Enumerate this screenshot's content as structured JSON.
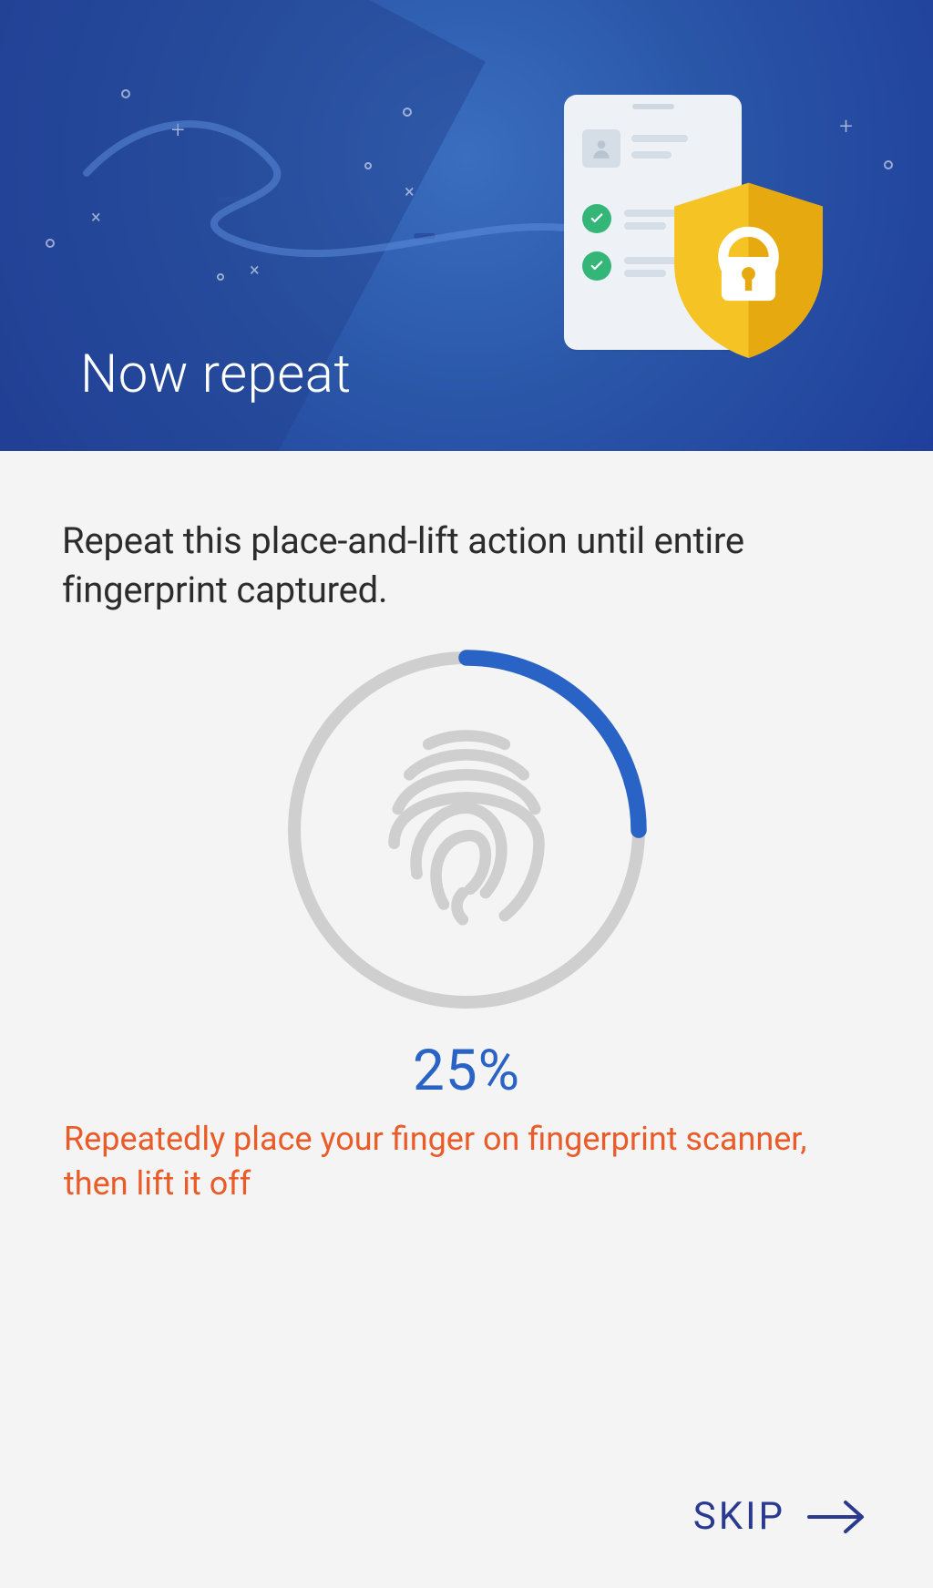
{
  "hero": {
    "title": "Now repeat"
  },
  "body": {
    "instruction": "Repeat this place-and-lift action until entire fingerprint captured.",
    "progress_percent": 25,
    "progress_label": "25%",
    "hint": "Repeatedly place your finger on fingerprint scanner, then lift it off"
  },
  "footer": {
    "skip_label": "SKIP"
  },
  "colors": {
    "accent_blue": "#2a63c6",
    "hint_orange": "#ea5b28",
    "footer_navy": "#2a3a8f",
    "ring_track": "#cfcfcf",
    "shield_yellow": "#f5c324",
    "shield_yellow_dark": "#e6a90f",
    "check_green": "#34b678"
  }
}
